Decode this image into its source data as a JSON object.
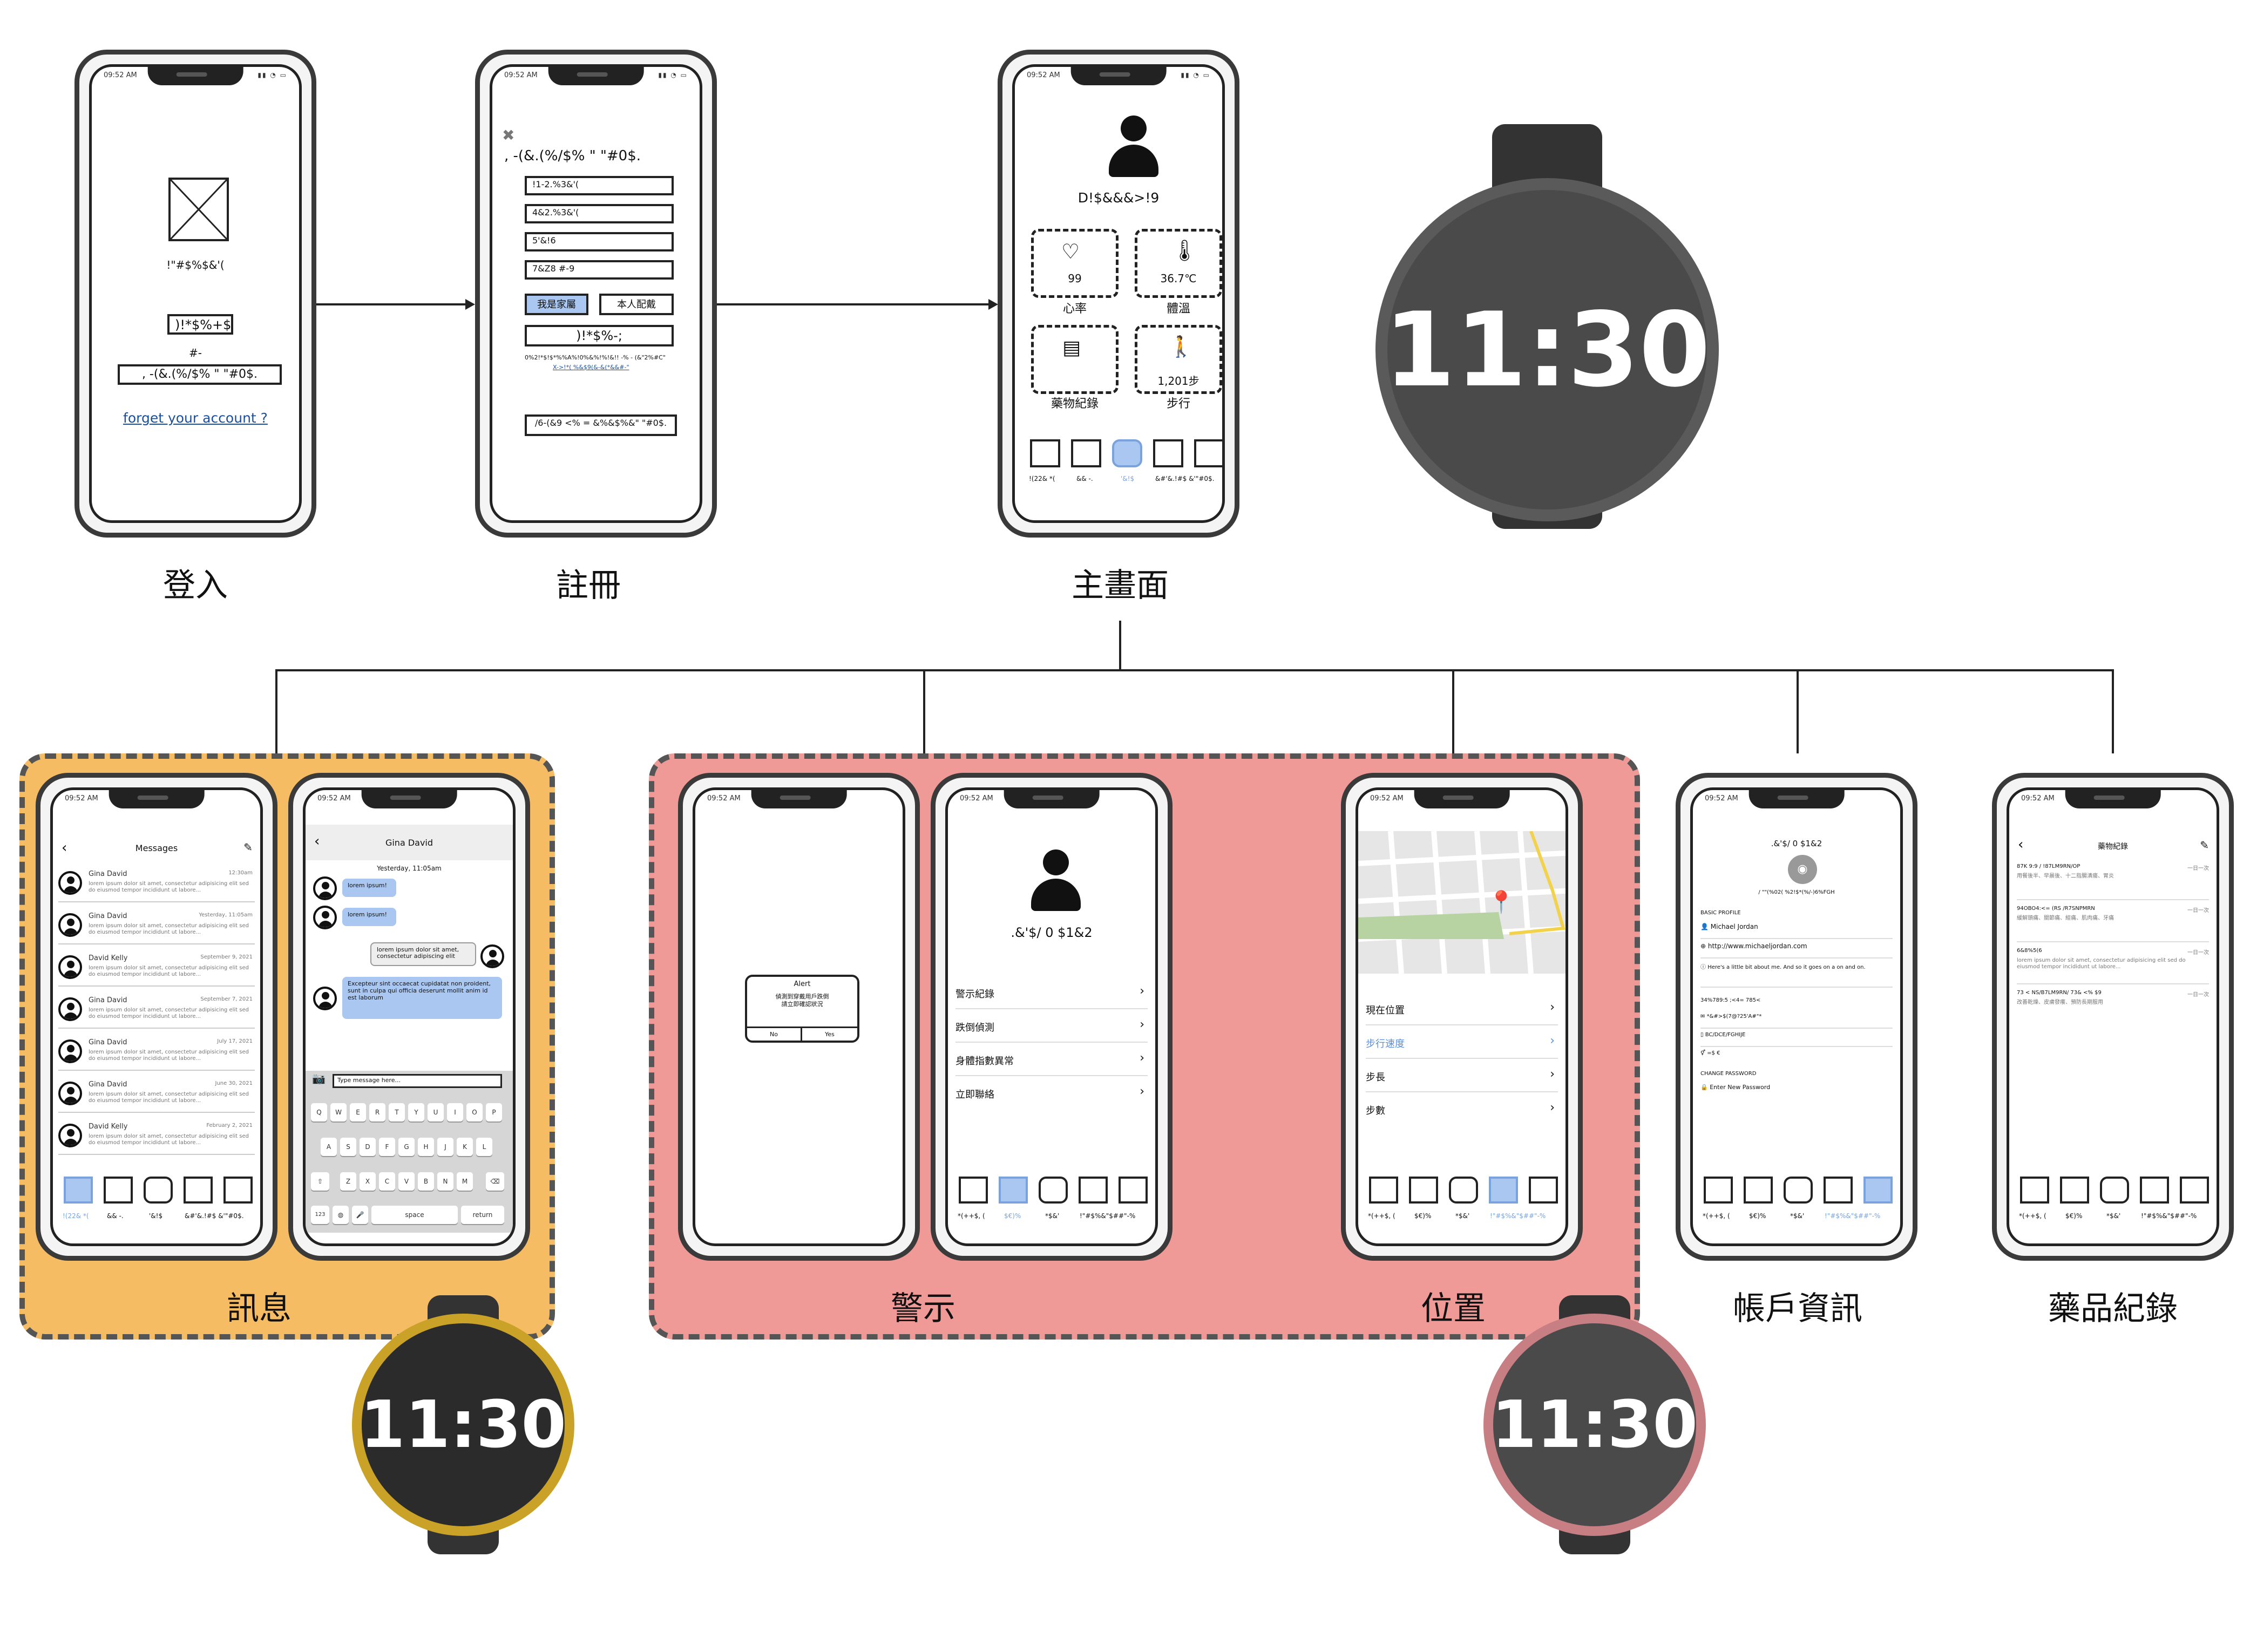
{
  "captions": {
    "login": "登入",
    "register": "註冊",
    "home": "主畫面",
    "messages": "訊息",
    "alert": "警示",
    "location": "位置",
    "account": "帳戶資訊",
    "medication": "藥品紀錄"
  },
  "colors": {
    "messages_group": "#F6BC63",
    "alert_group": "#EF9A97",
    "tab_active": "#A9C7F0",
    "watch_top_ring": "#5a5a5a",
    "watch_left_ring": "#C9A227",
    "watch_right_ring": "#C77F84"
  },
  "status_time": "09:52 AM",
  "watch_time": "11:30",
  "login": {
    "image_placeholder_icon": "image-placeholder-icon",
    "title": "!\"#$%$&'(",
    "button1": ")!*$%+$",
    "separator": "#-",
    "button2": ", -(&.(%/$% \" \"#0$.",
    "forgot_link": "forget your account ?"
  },
  "register": {
    "close_icon": "close-icon",
    "title": ", -(&.(%/$% \" \"#0$.",
    "fields": [
      "!1-2.%3&'(",
      "4&2.%3&'(",
      "5'&!6",
      "7&Z8 #-9"
    ],
    "role_family": "我是家屬",
    "role_self": "本人配戴",
    "submit": ")!*$%-;",
    "terms_line1": "0%2!*$!$*%%A%!0%&%!%!&!! -% - (&\"2%#C\"",
    "terms_line2": "X->!*( %&$9(&-&(*&&#-\"",
    "bottom_button": "/6-(&9 <% = &%&$%&\" \"#0$."
  },
  "home": {
    "user_icon": "user-icon",
    "user_name": "D!$&&&>!9",
    "cards": [
      {
        "icon": "heart-rate-icon",
        "value": "99",
        "label": "心率"
      },
      {
        "icon": "thermometer-icon",
        "value": "36.7℃",
        "label": "體溫"
      },
      {
        "icon": "notebook-icon",
        "value": "",
        "label": "藥物紀錄"
      },
      {
        "icon": "walking-icon",
        "value": "1,201步",
        "label": "步行"
      }
    ],
    "tabs": [
      "!(22& *(",
      "&& -.",
      "'&!$",
      "&#'&.!#$ &'\"#0$."
    ]
  },
  "messages": {
    "header": "Messages",
    "rows": [
      {
        "name": "Gina David",
        "time": "12:30am",
        "preview": "lorem ipsum dolor sit amet, consectetur adipisicing elit sed do eiusmod tempor incididunt ut labore..."
      },
      {
        "name": "Gina David",
        "time": "Yesterday, 11:05am",
        "preview": "lorem ipsum dolor sit amet, consectetur adipisicing elit sed do eiusmod tempor incididunt ut labore..."
      },
      {
        "name": "David Kelly",
        "time": "September 9, 2021",
        "preview": "lorem ipsum dolor sit amet, consectetur adipisicing elit sed do eiusmod tempor incididunt ut labore..."
      },
      {
        "name": "Gina David",
        "time": "September 7, 2021",
        "preview": "lorem ipsum dolor sit amet, consectetur adipisicing elit sed do eiusmod tempor incididunt ut labore..."
      },
      {
        "name": "Gina David",
        "time": "July 17, 2021",
        "preview": "lorem ipsum dolor sit amet, consectetur adipisicing elit sed do eiusmod tempor incididunt ut labore..."
      },
      {
        "name": "Gina David",
        "time": "June 30, 2021",
        "preview": "lorem ipsum dolor sit amet, consectetur adipisicing elit sed do eiusmod tempor incididunt ut labore..."
      },
      {
        "name": "David Kelly",
        "time": "February 2, 2021",
        "preview": "lorem ipsum dolor sit amet, consectetur adipisicing elit sed do eiusmod tempor incididunt ut labore..."
      }
    ],
    "tabs": [
      "!(22& *(",
      "&& -.",
      "'&!$",
      "&#'&.!#$ &'\"#0$."
    ]
  },
  "chat": {
    "header": "Gina David",
    "date": "Yesterday, 11:05am",
    "bubble1": "lorem ipsum!",
    "bubble2": "lorem ipsum!",
    "bubble3": "lorem ipsum dolor sit amet, consectetur adipiscing elit",
    "bubble4": "Excepteur sint occaecat cupidatat non proident, sunt in culpa qui officia deserunt mollit anim id est laborum",
    "input_placeholder": "Type message here...",
    "keys_row1": [
      "Q",
      "W",
      "E",
      "R",
      "T",
      "Y",
      "U",
      "I",
      "O",
      "P"
    ],
    "keys_row2": [
      "A",
      "S",
      "D",
      "F",
      "G",
      "H",
      "J",
      "K",
      "L"
    ],
    "keys_row3": [
      "Z",
      "X",
      "C",
      "V",
      "B",
      "N",
      "M"
    ],
    "key_123": "123",
    "key_space": "space",
    "key_return": "return"
  },
  "alert": {
    "dialog_title": "Alert",
    "dialog_body": "偵測到穿戴用戶跌倒\n請立即確認狀況",
    "no": "No",
    "yes": "Yes"
  },
  "alert_menu": {
    "user_name": ".&'$/ 0 $1&2",
    "items": [
      "警示紀錄",
      "跌倒偵測",
      "身體指數異常",
      "立即聯絡"
    ],
    "tabs": [
      "*(++$, (",
      "$€)%",
      "*$&'",
      "!\"#$%&\"$##\"-%"
    ]
  },
  "location": {
    "items": [
      "現在位置",
      "步行速度",
      "步長",
      "步數"
    ],
    "tabs": [
      "*(++$, (",
      "$€)%",
      "*$&'",
      "!\"#$%&\"$##\"-%"
    ]
  },
  "account": {
    "title": ".&'$/ 0 $1&2",
    "subtitle": "/ \"\"(%02( %2!$*(%/-)6%FGH",
    "section_basic": "BASIC PROFILE",
    "name": "Michael Jordan",
    "url": "http://www.michaeljordan.com",
    "bio": "Here's a little bit about me. And so it goes on a on and on.",
    "line1": "34%789:5 ;<4=  785<",
    "email": "*&#>$(7@?25'A#\"*",
    "phone": "BC/DCE/FGHIJE",
    "gender": "=$ €",
    "section_password": "CHANGE PASSWORD",
    "password_placeholder": "Enter New Password",
    "tabs": [
      "*(++$, (",
      "$€)%",
      "*$&'",
      "!\"#$%&\"$##\"-%"
    ]
  },
  "medication": {
    "header": "藥物紀錄",
    "entries": [
      {
        "title": "87K 9:9 / !87LM9RN/OP",
        "time": "一日一次",
        "body": "用餐後半、早晨後、十二指腸潰瘍、胃炎"
      },
      {
        "title": "94OBO4:<= (RS /R7SNPMRN",
        "time": "一日一次",
        "body": "緩解頭痛、關節痛、經痛、肌肉痛、牙痛"
      },
      {
        "title": "6&8%5(6",
        "time": "一日一次",
        "body": "lorem ipsum dolor sit amet, consectetur adipisicing elit sed do eiusmod tempor incididunt ut labore..."
      },
      {
        "title": "73  < NS/B7LM9RN/ 73& <% $9",
        "time": "一日一次",
        "body": "改善乾燥、皮膚發癢、預防長期服用"
      }
    ],
    "tabs": [
      "*(++$, (",
      "$€)%",
      "*$&'",
      "!\"#$%&\"$##\"-%"
    ]
  }
}
